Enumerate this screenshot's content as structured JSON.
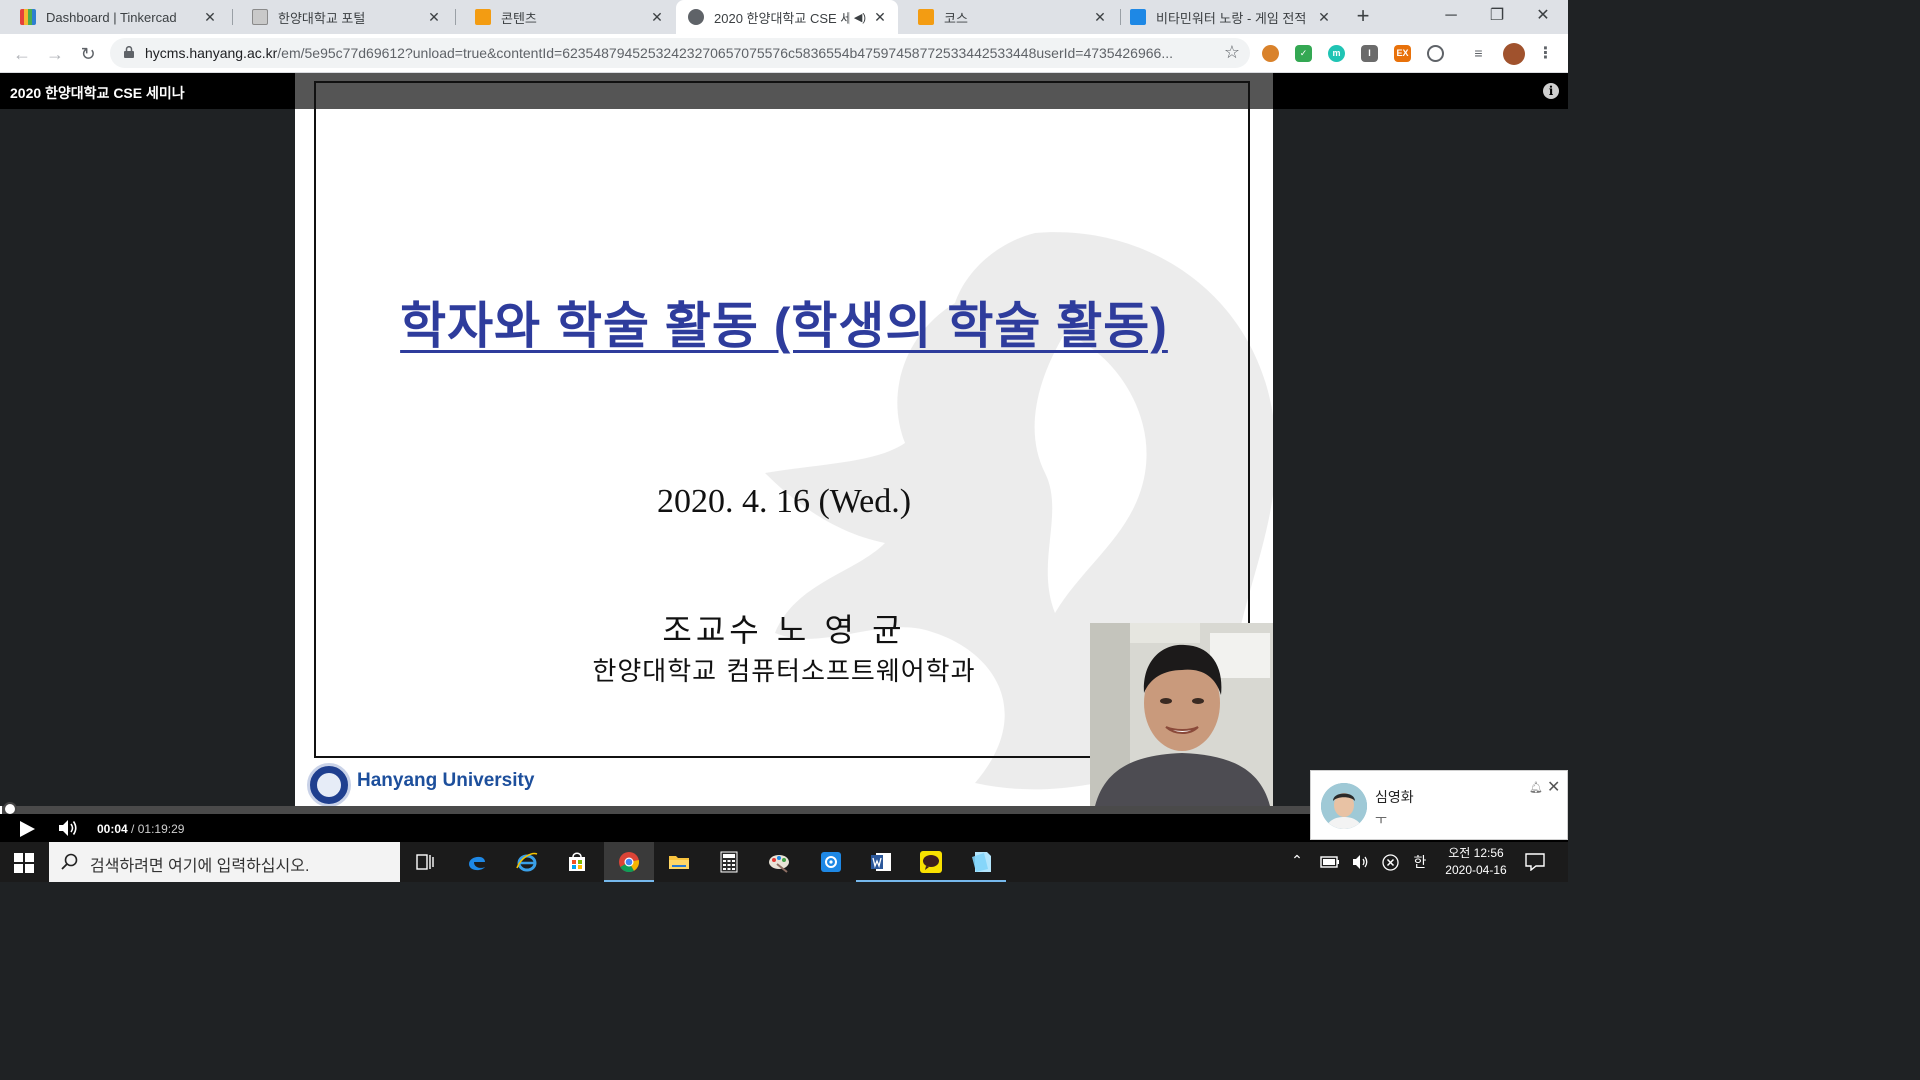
{
  "browser": {
    "tabs": [
      {
        "title": "Dashboard | Tinkercad",
        "favicon": "tinkercad-icon",
        "active": false
      },
      {
        "title": "한양대학교 포털",
        "favicon": "portal-icon",
        "active": false
      },
      {
        "title": "콘텐츠",
        "favicon": "pencil-icon",
        "active": false
      },
      {
        "title": "2020 한양대학교 CSE 세",
        "favicon": "globe-icon",
        "active": true,
        "audio": true
      },
      {
        "title": "코스",
        "favicon": "pencil-icon",
        "active": false
      },
      {
        "title": "비타민워터 노랑 - 게임 전적",
        "favicon": "opgg-icon",
        "active": false
      }
    ],
    "url_host": "hycms.hanyang.ac.kr",
    "url_path": "/em/5e95c77d69612?unload=true&contentId=62354879452532423270657075576c5836554b47597458772533442533448userId=4735426966..."
  },
  "player": {
    "course_title": "2020 한양대학교 CSE 세미나",
    "current_time": "00:04",
    "duration": "01:19:29",
    "time_separator": "/",
    "progress_fraction": 0.001
  },
  "slide": {
    "title": "학자와 학술 활동 (학생의 학술 활동)",
    "date": "2020. 4. 16 (Wed.)",
    "author": "조교수 노 영 균",
    "department": "한양대학교 컴퓨터소프트웨어학과",
    "university": "Hanyang University"
  },
  "notification": {
    "name": "심영화",
    "message": "ㅜ"
  },
  "taskbar": {
    "search_placeholder": "검색하려면 여기에 입력하십시오.",
    "ime": "한",
    "clock_ampm_time": "오전 12:56",
    "clock_date": "2020-04-16"
  },
  "colors": {
    "slide_title": "#2e3c9c",
    "university_name": "#1d4f9c",
    "taskbar_accent": "#76b9ed"
  }
}
